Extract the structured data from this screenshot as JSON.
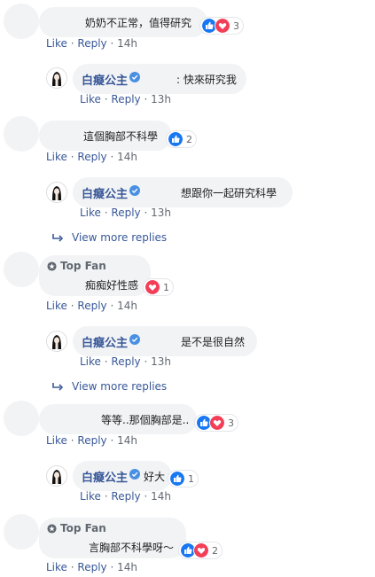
{
  "common": {
    "like": "Like",
    "reply": "Reply",
    "sep": "·",
    "view_more": "View more replies"
  },
  "c1": {
    "text": "奶奶不正常，值得研究",
    "time": "14h",
    "count": "3"
  },
  "r1": {
    "author": "白癡公主",
    "text": ": 快來研究我",
    "time": "13h"
  },
  "c2": {
    "text": "這個胸部不科學",
    "time": "14h",
    "count": "2"
  },
  "r2": {
    "author": "白癡公主",
    "text": "想跟你一起研究科學",
    "time": "13h"
  },
  "c3": {
    "badge": "Top Fan",
    "text": "痴痴好性感",
    "time": "14h",
    "count": "1"
  },
  "r3": {
    "author": "白癡公主",
    "text": "是不是很自然",
    "time": "13h"
  },
  "c4": {
    "text": "等等..那個胸部是..",
    "time": "14h",
    "count": "3"
  },
  "r4": {
    "author": "白癡公主",
    "text": "好大",
    "time": "14h",
    "count": "1"
  },
  "c5": {
    "badge": "Top Fan",
    "text": "言胸部不科學呀～",
    "time": "14h",
    "count": "2"
  },
  "colors": {
    "link": "#385898",
    "like_blue": "#1877f2",
    "love_red": "#f33e58",
    "bubble": "#f2f3f5"
  }
}
